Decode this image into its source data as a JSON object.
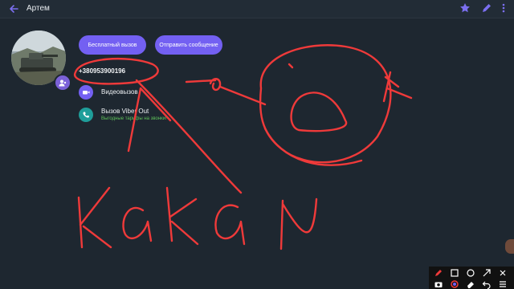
{
  "header": {
    "back_icon": "arrow-left-icon",
    "title": "Артем",
    "star_icon": "star-icon",
    "edit_icon": "pencil-icon",
    "menu_icon": "more-vertical-icon"
  },
  "profile": {
    "avatar": "contact-photo",
    "badge_icon": "viber-contact-icon"
  },
  "actions": {
    "free_call": "Бесплатный вызов",
    "send_message": "Отправить сообщение"
  },
  "contact": {
    "phone": "+380953900196",
    "video_call": "Видеовызов",
    "viber_out": "Вызов Viber Out",
    "viber_out_note": "Выгодные тарифы на звонки!"
  },
  "colors": {
    "background": "#1e2730",
    "accent": "#7360f2",
    "viber_out_teal": "#1f9e9a",
    "green_note": "#5fc25a",
    "annotation_ink": "#ef3a3a"
  },
  "drawing_overlay": {
    "handwritten_text": "KAK N"
  },
  "toolbar": {
    "tools": [
      "pen-icon",
      "rectangle-icon",
      "circle-icon",
      "arrow-icon",
      "close-icon",
      "camera-icon",
      "palette-icon",
      "eraser-icon",
      "undo-icon",
      "menu-icon"
    ]
  }
}
